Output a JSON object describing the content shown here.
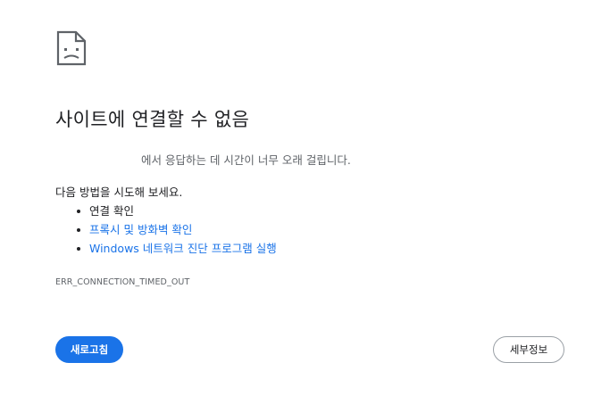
{
  "error": {
    "icon": "sad-page-icon",
    "title": "사이트에 연결할 수 없음",
    "host_name": "",
    "host_message": "에서 응답하는 데 시간이 너무 오래 걸립니다.",
    "suggestions_heading": "다음 방법을 시도해 보세요.",
    "suggestions": [
      {
        "label": "연결 확인",
        "is_link": false
      },
      {
        "label": "프록시 및 방화벽 확인",
        "is_link": true
      },
      {
        "label": "Windows 네트워크 진단 프로그램 실행",
        "is_link": true
      }
    ],
    "code": "ERR_CONNECTION_TIMED_OUT"
  },
  "buttons": {
    "reload_label": "새로고침",
    "details_label": "세부정보"
  },
  "colors": {
    "accent": "#1a73e8",
    "text": "#202124",
    "secondary_text": "#5f6368"
  }
}
